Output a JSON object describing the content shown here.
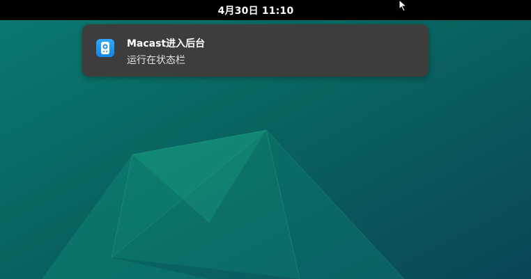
{
  "topbar": {
    "clock": "4月30日  11:10"
  },
  "notification": {
    "app_icon": "speaker-icon",
    "title": "Macast进入后台",
    "body": "运行在状态栏"
  },
  "colors": {
    "topbar": "#000000",
    "notification_bg": "#3d3d3d",
    "app_icon_blue": "#1a8ef0",
    "wallpaper_teal": "#0a6f6b"
  }
}
